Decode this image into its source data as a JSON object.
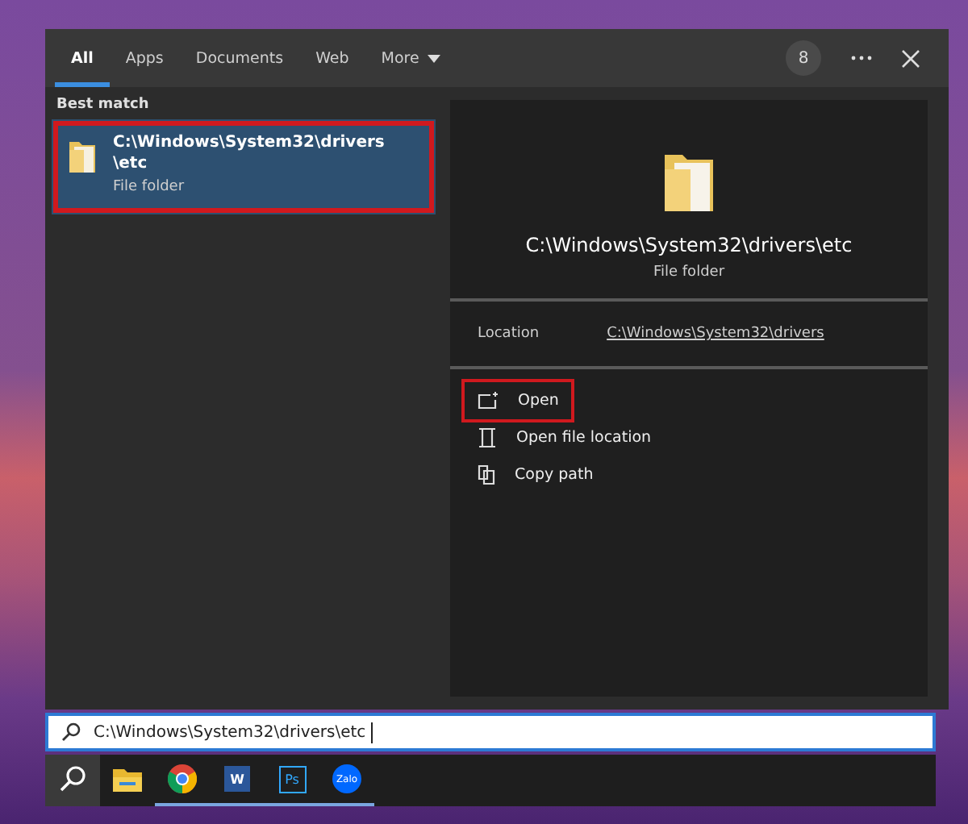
{
  "tabs": [
    {
      "label": "All",
      "selected": true,
      "dropdown": false
    },
    {
      "label": "Apps",
      "selected": false,
      "dropdown": false
    },
    {
      "label": "Documents",
      "selected": false,
      "dropdown": false
    },
    {
      "label": "Web",
      "selected": false,
      "dropdown": false
    },
    {
      "label": "More",
      "selected": false,
      "dropdown": true
    }
  ],
  "badge": "8",
  "best_match": {
    "heading": "Best match",
    "title": "C:\\Windows\\System32\\drivers\\etc",
    "subtitle": "File folder",
    "selected": true,
    "highlighted": true
  },
  "detail": {
    "title": "C:\\Windows\\System32\\drivers\\etc",
    "subtitle": "File folder",
    "location_label": "Location",
    "location_link": "C:\\Windows\\System32\\drivers",
    "actions": [
      {
        "kind": "open",
        "label": "Open",
        "highlighted": true
      },
      {
        "kind": "location",
        "label": "Open file location",
        "highlighted": false
      },
      {
        "kind": "copy",
        "label": "Copy path",
        "highlighted": false
      }
    ]
  },
  "search": {
    "value": "C:\\Windows\\System32\\drivers\\etc"
  },
  "taskbar": [
    {
      "kind": "search",
      "active": true
    },
    {
      "kind": "explorer",
      "running": false
    },
    {
      "kind": "chrome",
      "running": true
    },
    {
      "kind": "word",
      "label": "W",
      "running": true
    },
    {
      "kind": "photoshop",
      "label": "Ps",
      "running": true
    },
    {
      "kind": "zalo",
      "label": "Zalo",
      "running": true
    }
  ]
}
